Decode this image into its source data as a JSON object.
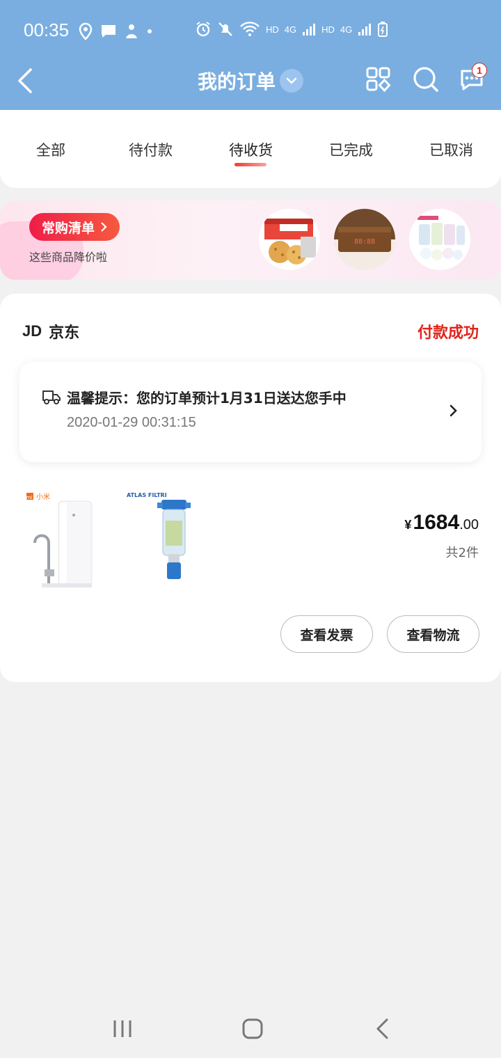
{
  "status_bar": {
    "time": "00:35",
    "hd1": "HD",
    "net1": "4G",
    "hd2": "HD",
    "net2": "4G"
  },
  "header": {
    "title": "我的订单",
    "badge_count": "1"
  },
  "tabs": [
    {
      "label": "全部"
    },
    {
      "label": "待付款"
    },
    {
      "label": "待收货"
    },
    {
      "label": "已完成"
    },
    {
      "label": "已取消"
    }
  ],
  "banner": {
    "pill_label": "常购清单",
    "subtitle": "这些商品降价啦"
  },
  "order": {
    "shop_logo": "JD",
    "shop_name": "京东",
    "status": "付款成功",
    "notice_text": "温馨提示：您的订单预计1月31日送达您手中",
    "notice_time": "2020-01-29 00:31:15",
    "product1_brand": "小米",
    "product2_brand": "ATLAS FILTRI",
    "price_currency": "¥",
    "price_int": "1684",
    "price_dec": ".00",
    "item_count": "共2件",
    "btn_invoice": "查看发票",
    "btn_logistics": "查看物流"
  },
  "colors": {
    "header_bg": "#7aaee0",
    "accent_red": "#e2231a"
  }
}
